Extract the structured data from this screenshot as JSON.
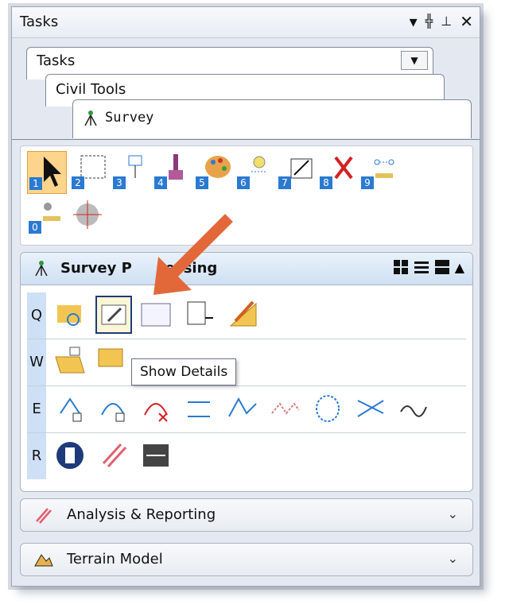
{
  "window": {
    "title": "Tasks"
  },
  "tabs": {
    "tasks_label": "Tasks",
    "civil_tools_label": "Civil Tools",
    "survey_label": "Survey"
  },
  "toolbar": {
    "numbers": [
      "1",
      "2",
      "3",
      "4",
      "5",
      "6",
      "7",
      "8",
      "9",
      "0"
    ]
  },
  "survey_processing": {
    "title": "Survey Processing",
    "title_visible": "Survey P",
    "title_tail": "essing",
    "rows": [
      {
        "key": "Q"
      },
      {
        "key": "W"
      },
      {
        "key": "E"
      },
      {
        "key": "R"
      }
    ]
  },
  "tooltip": {
    "text": "Show Details"
  },
  "analysis": {
    "label": "Analysis & Reporting"
  },
  "terrain": {
    "label": "Terrain Model"
  },
  "colors": {
    "accent_arrow": "#e2683a",
    "selected": "#fcd48c",
    "row_label_bg": "#cde0f6"
  }
}
